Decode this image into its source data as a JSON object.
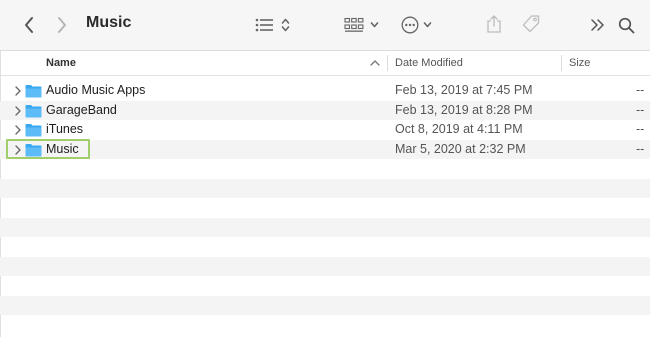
{
  "toolbar": {
    "title": "Music",
    "icons": [
      "chevron-left-icon",
      "chevron-right-icon",
      "list-view-icon",
      "group-grid-icon",
      "ellipsis-circle-icon",
      "share-icon",
      "tag-icon",
      "overflow-chevrons-icon",
      "search-icon"
    ]
  },
  "columns": {
    "name": "Name",
    "date": "Date Modified",
    "size": "Size"
  },
  "rows": [
    {
      "name": "Audio Music Apps",
      "date": "Feb 13, 2019 at 7:45 PM",
      "size": "--"
    },
    {
      "name": "GarageBand",
      "date": "Feb 13, 2019 at 8:28 PM",
      "size": "--"
    },
    {
      "name": "iTunes",
      "date": "Oct 8, 2019 at 4:11 PM",
      "size": "--"
    },
    {
      "name": "Music",
      "date": "Mar 5, 2020 at 2:32 PM",
      "size": "--"
    }
  ],
  "colors": {
    "folder": "#3aa9f2",
    "highlight": "#9fce6b",
    "stripe": "#f4f4f5",
    "toolbar_bg": "#f6f6f6"
  }
}
